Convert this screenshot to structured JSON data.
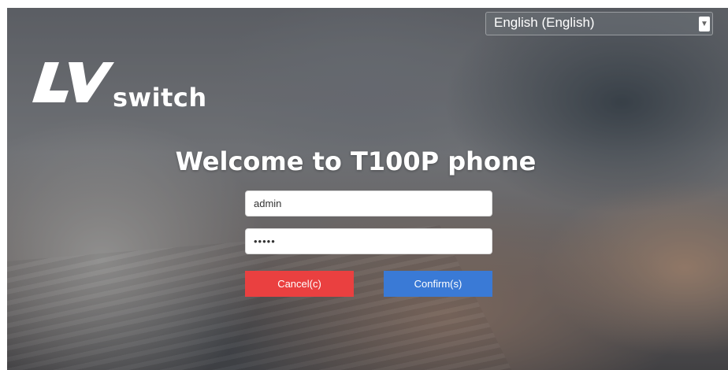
{
  "language": {
    "selected": "English (English)",
    "caret_icon": "chevron-down-icon"
  },
  "brand": {
    "logo_text": "switch",
    "logo_icon": "lv-logo-icon"
  },
  "page": {
    "welcome_title": "Welcome to T100P phone"
  },
  "login": {
    "username_value": "admin",
    "password_value": "admin"
  },
  "buttons": {
    "cancel_label": "Cancel(c)",
    "confirm_label": "Confirm(s)"
  },
  "colors": {
    "cancel": "#ea4040",
    "confirm": "#3a7ad6",
    "text": "#ffffff"
  }
}
